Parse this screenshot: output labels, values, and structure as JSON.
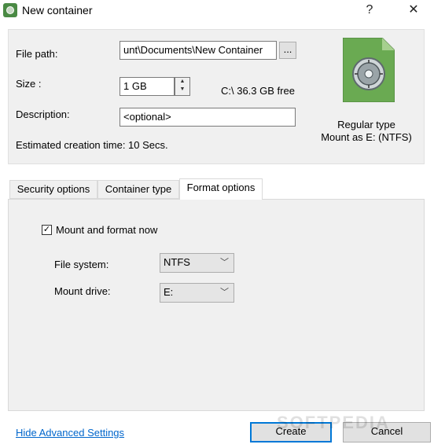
{
  "window": {
    "title": "New container",
    "help_label": "?",
    "close_label": "✕"
  },
  "form": {
    "file_path_label": "File path:",
    "file_path_value": "unt\\Documents\\New Container",
    "browse_label": "...",
    "size_label": "Size :",
    "size_value": "1 GB",
    "free_space": "C:\\ 36.3 GB free",
    "description_label": "Description:",
    "description_value": "<optional>",
    "estimated_time": "Estimated creation time: 10 Secs."
  },
  "container_info": {
    "type_text": "Regular type",
    "mount_text": "Mount as E: (NTFS)",
    "icon": "safe-file-icon"
  },
  "tabs": [
    {
      "label": "Security options",
      "active": false
    },
    {
      "label": "Container type",
      "active": false
    },
    {
      "label": "Format options",
      "active": true
    }
  ],
  "format_options": {
    "mount_format_label": "Mount and format now",
    "mount_format_checked": true,
    "file_system_label": "File system:",
    "file_system_value": "NTFS",
    "mount_drive_label": "Mount drive:",
    "mount_drive_value": "E:"
  },
  "footer": {
    "advanced_link": "Hide Advanced Settings",
    "create_label": "Create",
    "cancel_label": "Cancel"
  },
  "watermark": "SOFTPEDIA",
  "colors": {
    "accent": "#0078d7",
    "link": "#0066cc",
    "icon_green": "#4a8a44"
  }
}
